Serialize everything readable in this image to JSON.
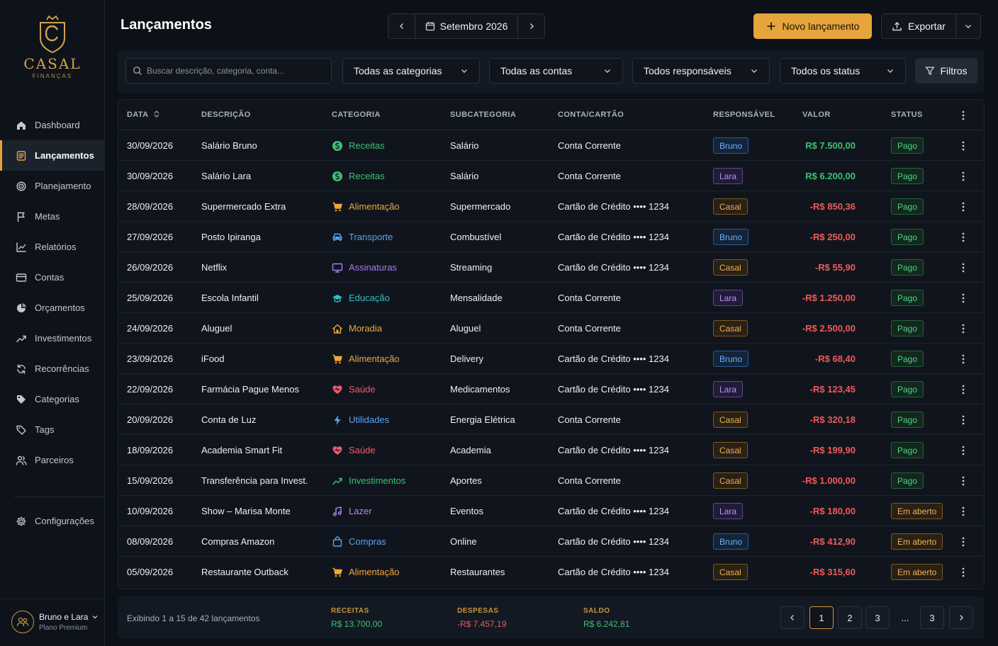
{
  "brand": {
    "name": "CASAL",
    "sub": "FINANÇAS"
  },
  "nav": [
    {
      "label": "Dashboard",
      "icon": "home-icon"
    },
    {
      "label": "Lançamentos",
      "icon": "list-icon",
      "active": true
    },
    {
      "label": "Planejamento",
      "icon": "target-icon"
    },
    {
      "label": "Metas",
      "icon": "flag-icon"
    },
    {
      "label": "Relatórios",
      "icon": "chart-icon"
    },
    {
      "label": "Contas",
      "icon": "card-icon"
    },
    {
      "label": "Orçamentos",
      "icon": "pie-icon"
    },
    {
      "label": "Investimentos",
      "icon": "trend-icon"
    },
    {
      "label": "Recorrências",
      "icon": "refresh-icon"
    },
    {
      "label": "Categorias",
      "icon": "tag-icon"
    },
    {
      "label": "Tags",
      "icon": "tag-outline-icon"
    },
    {
      "label": "Parceiros",
      "icon": "users-icon"
    }
  ],
  "config_label": "Configurações",
  "user": {
    "name": "Bruno e Lara",
    "plan": "Plano Premium"
  },
  "header": {
    "title": "Lançamentos",
    "month": "Setembro 2026",
    "new_label": "Novo lançamento",
    "export_label": "Exportar"
  },
  "filters": {
    "search_placeholder": "Buscar descrição, categoria, conta...",
    "category": "Todas as categorias",
    "account": "Todas as contas",
    "owner": "Todos responsáveis",
    "status": "Todos os status",
    "filters_label": "Filtros"
  },
  "table": {
    "headers": {
      "date": "DATA",
      "desc": "DESCRIÇÃO",
      "cat": "CATEGORIA",
      "sub": "SUBCATEGORIA",
      "account": "CONTA/CARTÃO",
      "owner": "RESPONSÁVEL",
      "value": "VALOR",
      "status": "STATUS"
    },
    "rows": [
      {
        "date": "30/09/2026",
        "desc": "Salário Bruno",
        "cat": "Receitas",
        "cat_icon": "dollar-icon",
        "cat_color": "#3cc173",
        "sub": "Salário",
        "account": "Conta Corrente",
        "owner": "Bruno",
        "value": "R$ 7.500,00",
        "positive": true,
        "status": "Pago"
      },
      {
        "date": "30/09/2026",
        "desc": "Salário Lara",
        "cat": "Receitas",
        "cat_icon": "dollar-icon",
        "cat_color": "#3cc173",
        "sub": "Salário",
        "account": "Conta Corrente",
        "owner": "Lara",
        "value": "R$ 6.200,00",
        "positive": true,
        "status": "Pago"
      },
      {
        "date": "28/09/2026",
        "desc": "Supermercado Extra",
        "cat": "Alimentação",
        "cat_icon": "cart-icon",
        "cat_color": "#f0a63a",
        "sub": "Supermercado",
        "account": "Cartão de Crédito •••• 1234",
        "owner": "Casal",
        "value": "-R$ 850,36",
        "positive": false,
        "status": "Pago"
      },
      {
        "date": "27/09/2026",
        "desc": "Posto Ipiranga",
        "cat": "Transporte",
        "cat_icon": "car-icon",
        "cat_color": "#5aa3f0",
        "sub": "Combustível",
        "account": "Cartão de Crédito •••• 1234",
        "owner": "Bruno",
        "value": "-R$ 250,00",
        "positive": false,
        "status": "Pago"
      },
      {
        "date": "26/09/2026",
        "desc": "Netflix",
        "cat": "Assinaturas",
        "cat_icon": "monitor-icon",
        "cat_color": "#a57bf0",
        "sub": "Streaming",
        "account": "Cartão de Crédito •••• 1234",
        "owner": "Casal",
        "value": "-R$ 55,90",
        "positive": false,
        "status": "Pago"
      },
      {
        "date": "25/09/2026",
        "desc": "Escola Infantil",
        "cat": "Educação",
        "cat_icon": "graduation-icon",
        "cat_color": "#2fc0c7",
        "sub": "Mensalidade",
        "account": "Conta Corrente",
        "owner": "Lara",
        "value": "-R$ 1.250,00",
        "positive": false,
        "status": "Pago"
      },
      {
        "date": "24/09/2026",
        "desc": "Aluguel",
        "cat": "Moradia",
        "cat_icon": "house-icon",
        "cat_color": "#f0a63a",
        "sub": "Aluguel",
        "account": "Conta Corrente",
        "owner": "Casal",
        "value": "-R$ 2.500,00",
        "positive": false,
        "status": "Pago"
      },
      {
        "date": "23/09/2026",
        "desc": "iFood",
        "cat": "Alimentação",
        "cat_icon": "cart-icon",
        "cat_color": "#f0a63a",
        "sub": "Delivery",
        "account": "Cartão de Crédito •••• 1234",
        "owner": "Bruno",
        "value": "-R$ 68,40",
        "positive": false,
        "status": "Pago"
      },
      {
        "date": "22/09/2026",
        "desc": "Farmácia Pague Menos",
        "cat": "Saúde",
        "cat_icon": "heart-icon",
        "cat_color": "#f05a6e",
        "sub": "Medicamentos",
        "account": "Cartão de Crédito •••• 1234",
        "owner": "Lara",
        "value": "-R$ 123,45",
        "positive": false,
        "status": "Pago"
      },
      {
        "date": "20/09/2026",
        "desc": "Conta de Luz",
        "cat": "Utilidades",
        "cat_icon": "bolt-icon",
        "cat_color": "#5aa3f0",
        "sub": "Energia Elétrica",
        "account": "Conta Corrente",
        "owner": "Casal",
        "value": "-R$ 320,18",
        "positive": false,
        "status": "Pago"
      },
      {
        "date": "18/09/2026",
        "desc": "Academia Smart Fit",
        "cat": "Saúde",
        "cat_icon": "heart-icon",
        "cat_color": "#f05a6e",
        "sub": "Academia",
        "account": "Cartão de Crédito •••• 1234",
        "owner": "Casal",
        "value": "-R$ 199,90",
        "positive": false,
        "status": "Pago"
      },
      {
        "date": "15/09/2026",
        "desc": "Transferência para Invest.",
        "cat": "Investimentos",
        "cat_icon": "trend-icon",
        "cat_color": "#3cc173",
        "sub": "Aportes",
        "account": "Conta Corrente",
        "owner": "Casal",
        "value": "-R$ 1.000,00",
        "positive": false,
        "status": "Pago"
      },
      {
        "date": "10/09/2026",
        "desc": "Show – Marisa Monte",
        "cat": "Lazer",
        "cat_icon": "music-icon",
        "cat_color": "#b08af0",
        "sub": "Eventos",
        "account": "Cartão de Crédito •••• 1234",
        "owner": "Lara",
        "value": "-R$ 180,00",
        "positive": false,
        "status": "Em aberto"
      },
      {
        "date": "08/09/2026",
        "desc": "Compras Amazon",
        "cat": "Compras",
        "cat_icon": "bag-icon",
        "cat_color": "#5aa3f0",
        "sub": "Online",
        "account": "Cartão de Crédito •••• 1234",
        "owner": "Bruno",
        "value": "-R$ 412,90",
        "positive": false,
        "status": "Em aberto"
      },
      {
        "date": "05/09/2026",
        "desc": "Restaurante Outback",
        "cat": "Alimentação",
        "cat_icon": "cart-icon",
        "cat_color": "#f0a63a",
        "sub": "Restaurantes",
        "account": "Cartão de Crédito •••• 1234",
        "owner": "Casal",
        "value": "-R$ 315,60",
        "positive": false,
        "status": "Em aberto"
      }
    ]
  },
  "footer": {
    "info": "Exibindo 1 a 15 de 42 lançamentos",
    "income_label": "RECEITAS",
    "income": "R$ 13.700,00",
    "expense_label": "DESPESAS",
    "expense": "-R$ 7.457,19",
    "balance_label": "SALDO",
    "balance": "R$ 6.242,81",
    "pages": [
      "1",
      "2",
      "3",
      "...",
      "3"
    ]
  },
  "colors": {
    "accent": "#e5a53c",
    "positive": "#3cc173",
    "negative": "#f05a5a",
    "owner_bruno": "#5aa3f0",
    "owner_lara": "#a57bf0",
    "owner_casal": "#e5a53c",
    "status_paid": "#3cc173",
    "status_open": "#e5a53c"
  }
}
